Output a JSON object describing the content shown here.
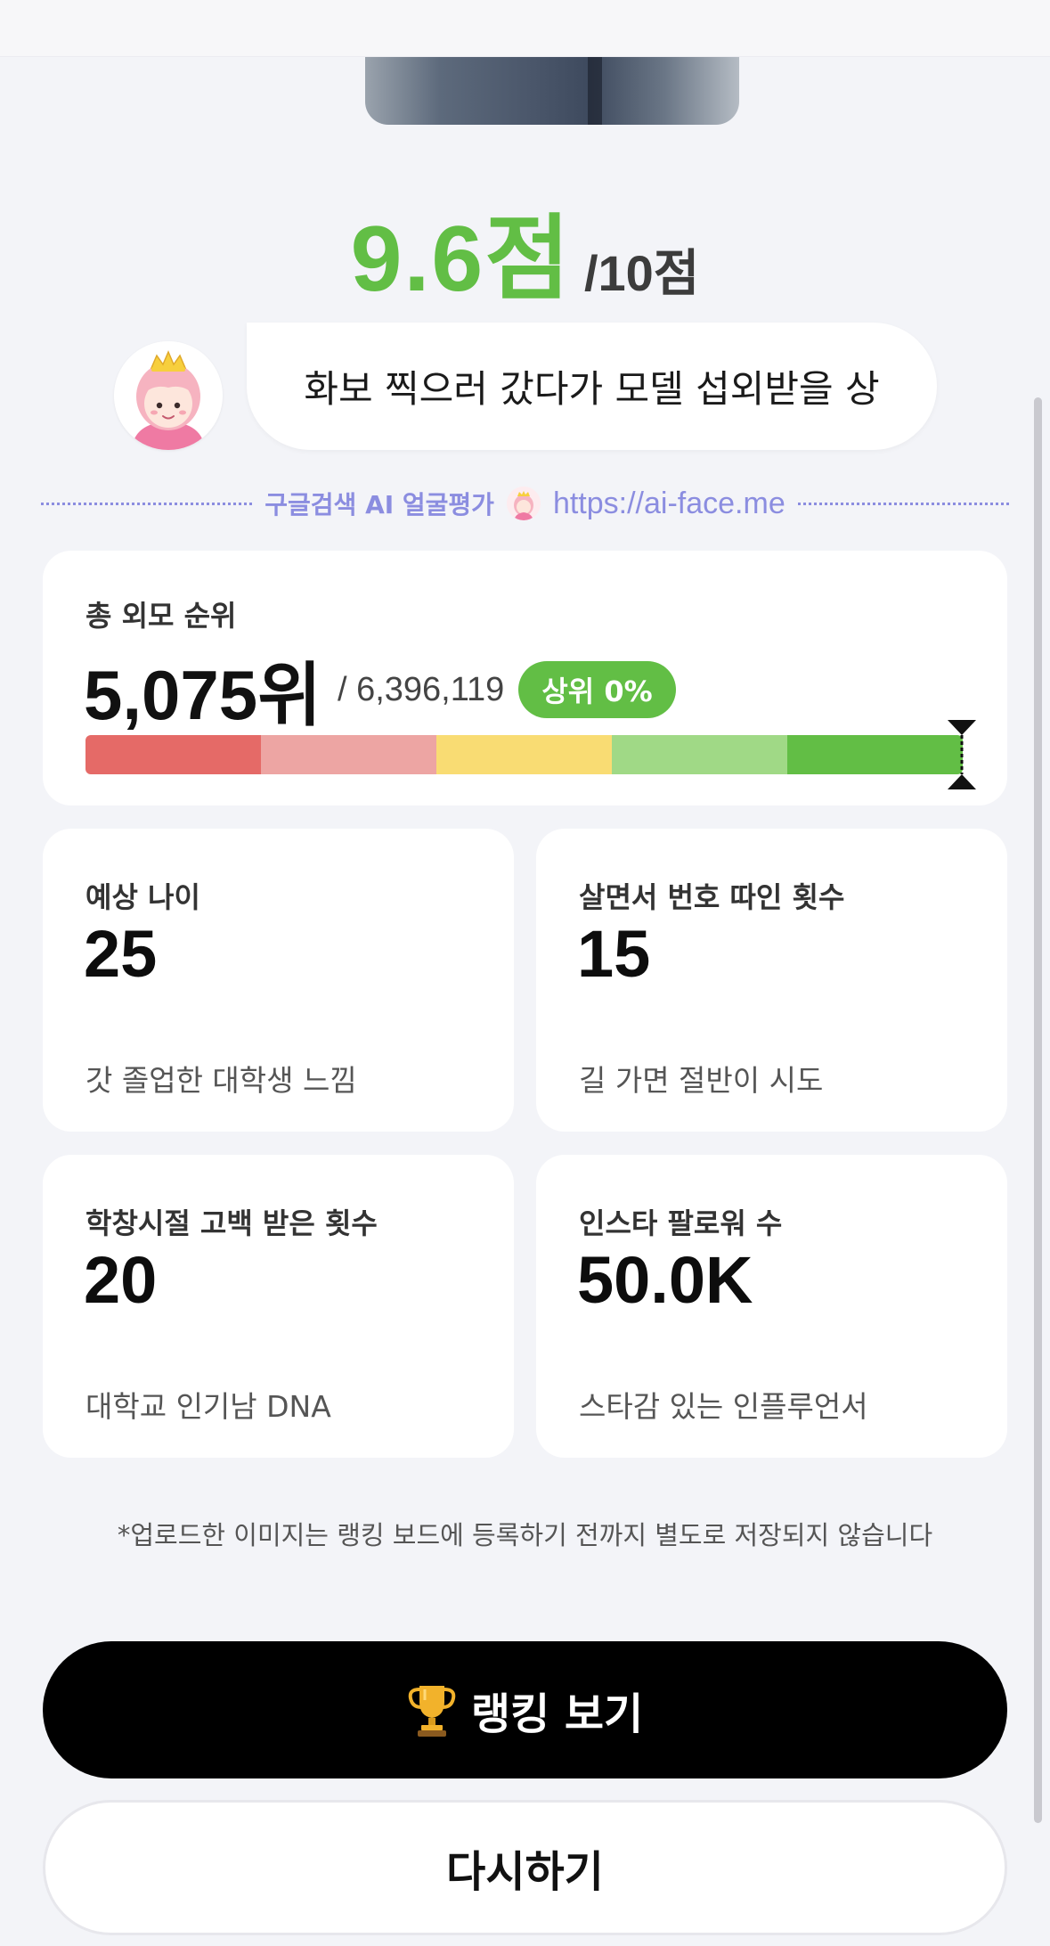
{
  "score": {
    "value": "9.6점",
    "max": "/10점"
  },
  "comment": "화보 찍으러 갔다가 모델 섭외받을 상",
  "divider": {
    "brand": "구글검색 AI 얼굴평가",
    "url": "https://ai-face.me"
  },
  "rank": {
    "label": "총 외모 순위",
    "value": "5,075위",
    "total": "/ 6,396,119",
    "badge": "상위 0%",
    "percentile": 0.08,
    "colors": [
      "#e56a67",
      "#eda5a3",
      "#f9dc73",
      "#a0d986",
      "#62be45"
    ]
  },
  "stats": [
    {
      "label": "예상 나이",
      "value": "25",
      "desc": "갓 졸업한 대학생 느낌"
    },
    {
      "label": "살면서 번호 따인 횟수",
      "value": "15",
      "desc": "길 가면 절반이 시도"
    },
    {
      "label": "학창시절 고백 받은 횟수",
      "value": "20",
      "desc": "대학교 인기남 DNA"
    },
    {
      "label": "인스타 팔로워 수",
      "value": "50.0K",
      "desc": "스타감 있는 인플루언서"
    }
  ],
  "notice": "*업로드한 이미지는 랭킹 보드에 등록하기 전까지 별도로 저장되지 않습니다",
  "buttons": {
    "ranking": "랭킹 보기",
    "retry": "다시하기"
  },
  "accent_color": "#62be45",
  "brand_color": "#8b8de0"
}
